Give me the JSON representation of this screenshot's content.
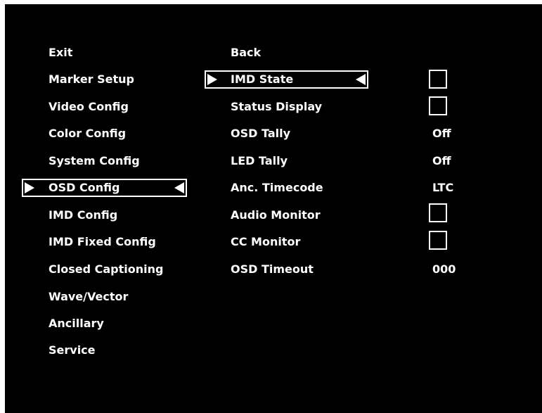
{
  "left_menu": {
    "items": [
      {
        "label": "Exit"
      },
      {
        "label": "Marker Setup"
      },
      {
        "label": "Video Config"
      },
      {
        "label": "Color Config"
      },
      {
        "label": "System Config"
      },
      {
        "label": "OSD Config",
        "selected": true
      },
      {
        "label": "IMD Config"
      },
      {
        "label": "IMD Fixed Config"
      },
      {
        "label": "Closed Captioning"
      },
      {
        "label": "Wave/Vector"
      },
      {
        "label": "Ancillary"
      },
      {
        "label": "Service"
      }
    ]
  },
  "right_menu": {
    "items": [
      {
        "label": "Back"
      },
      {
        "label": "IMD State",
        "selected": true,
        "checked": false
      },
      {
        "label": "Status Display",
        "checked": false
      },
      {
        "label": "OSD Tally",
        "value": "Off"
      },
      {
        "label": "LED Tally",
        "value": "Off"
      },
      {
        "label": "Anc. Timecode",
        "value": "LTC"
      },
      {
        "label": "Audio Monitor",
        "checked": false
      },
      {
        "label": "CC Monitor",
        "checked": false
      },
      {
        "label": "OSD Timeout",
        "value": "000"
      }
    ]
  },
  "colors": {
    "background": "#000000",
    "text": "#ffffff",
    "selection_border": "#ffffff"
  }
}
